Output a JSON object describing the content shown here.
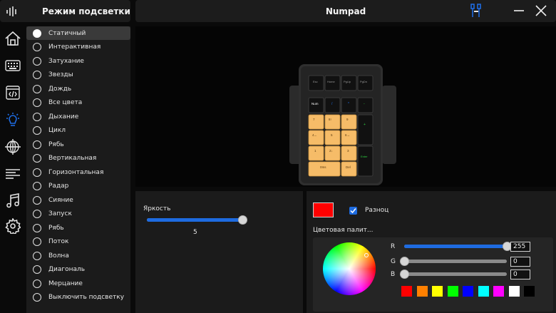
{
  "header": {
    "title": "Режим подсветки",
    "logo_icon": "equalizer-logo-icon"
  },
  "main_header": {
    "title": "Numpad",
    "icons": [
      "usb-icon",
      "minimize-icon",
      "close-icon"
    ]
  },
  "sidebar_icons": [
    "home-icon",
    "keyboard-icon",
    "macro-icon",
    "lighting-icon",
    "globe-icon",
    "list-icon",
    "music-icon",
    "settings-icon"
  ],
  "modes": [
    "Статичный",
    "Интерактивная",
    "Затухание",
    "Звезды",
    "Дождь",
    "Все цвета",
    "Дыхание",
    "Цикл",
    "Рябь",
    "Вертикальная",
    "Горизонтальная",
    "Радар",
    "Сияние",
    "Запуск",
    "Рябь",
    "Поток",
    "Волна",
    "Диагональ",
    "Мерцание",
    "Выключить подсветку"
  ],
  "active_mode": "Статичный",
  "keypad": {
    "top_row": [
      "Esc",
      "Home",
      "PgUp",
      "PgDn"
    ],
    "row1": [
      "Num",
      "/",
      "*",
      "-"
    ],
    "row2": [
      "7",
      "8↑",
      "9"
    ],
    "row3": [
      "4←",
      "5",
      "6→"
    ],
    "row4": [
      "1",
      "2↓",
      "3"
    ],
    "row5": [
      "0Ins",
      "Del"
    ],
    "plus": "+",
    "enter": "Enter"
  },
  "brightness": {
    "label": "Яркость",
    "value": "5",
    "level_fraction": 1.0
  },
  "color": {
    "selected_hex": "#ff0000",
    "random_label": "Разноц",
    "random_checked": true,
    "palette_label": "Цветовая палит...",
    "r_label": "R",
    "g_label": "G",
    "b_label": "B",
    "r": "255",
    "g": "0",
    "b": "0",
    "r_fraction": 1.0,
    "g_fraction": 0.0,
    "b_fraction": 0.0,
    "swatches": [
      "#ff0000",
      "#ff8000",
      "#ffff00",
      "#00ff00",
      "#0000ff",
      "#00ffff",
      "#ff00ff",
      "#ffffff",
      "#000000"
    ]
  },
  "accent": "#1e6be0",
  "keycap_color": "#f6bc68"
}
